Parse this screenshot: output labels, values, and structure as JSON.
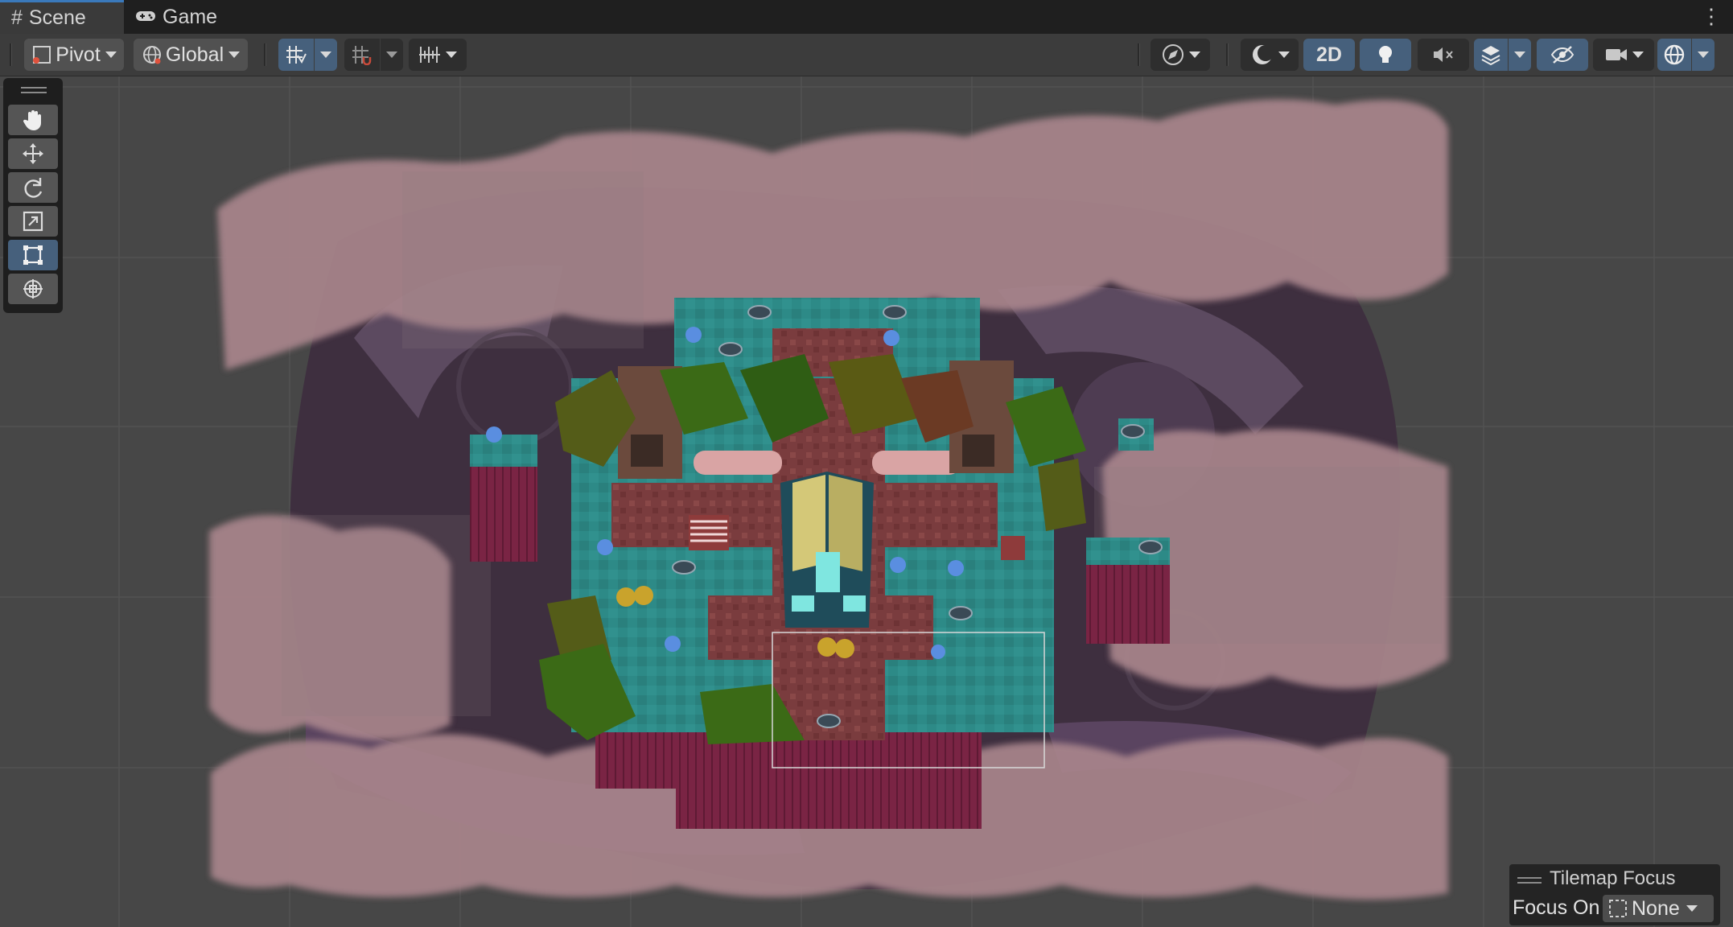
{
  "tabs": [
    {
      "label": "Scene",
      "icon": "hash-grid-icon",
      "active": true
    },
    {
      "label": "Game",
      "icon": "gamepad-icon",
      "active": false
    }
  ],
  "toolbar": {
    "pivot_label": "Pivot",
    "global_label": "Global",
    "mode_2d_label": "2D"
  },
  "tilemap_focus": {
    "title": "Tilemap Focus",
    "focus_on_label": "Focus On",
    "focus_value": "None"
  },
  "colors": {
    "accent": "#46607c",
    "panel": "#3c3c3c",
    "scene_bg": "#474747",
    "teal_tiles": "#2e8a86",
    "cloud_pink": "#b08a90"
  }
}
